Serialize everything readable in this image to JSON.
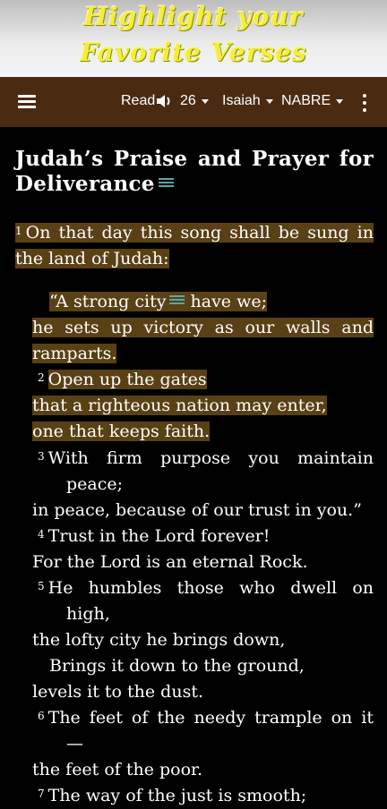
{
  "banner": {
    "line1": "Highlight your",
    "line2": "Favorite Verses"
  },
  "toolbar": {
    "read_label": "Read",
    "chapter": "26",
    "book": "Isaiah",
    "version": "NABRE"
  },
  "heading": "Judah’s Praise and Prayer for Deliverance",
  "lines": {
    "l1a": "On that day this song shall be sung in",
    "l1b": "the land of Judah:",
    "l1c": "“A strong city",
    "l1c2": " have we;",
    "l1d": "he sets up victory as our walls and",
    "l1e": "ramparts.",
    "l2a": "Open up the gates",
    "l2b": "that a righteous nation may enter,",
    "l2c": "one that keeps faith.",
    "l3a": "With firm purpose you maintain",
    "l3b": "peace;",
    "l3c": "in peace, because of our trust in you.”",
    "l4a": "Trust in the Lord forever!",
    "l4b": "For the Lord is an eternal Rock.",
    "l5a": "He humbles those who dwell on",
    "l5b": "high,",
    "l5c": "the lofty city he brings down,",
    "l5d": "Brings it down to the ground,",
    "l5e": "levels it to the dust.",
    "l6a": "The feet of the needy trample on it",
    "l6b": "—",
    "l6c": "the feet of the poor.",
    "l7a": "The way of the just is smooth;"
  },
  "verse_numbers": {
    "v1": "1",
    "v2": "2",
    "v3": "3",
    "v4": "4",
    "v5": "5",
    "v6": "6",
    "v7": "7"
  },
  "colors": {
    "toolbar": "#4a2b12",
    "highlight": "#5a4015",
    "footnote": "#5aa7a0",
    "banner_text": "#f2ee3a"
  },
  "icons": {
    "menu": "hamburger-menu-icon",
    "speaker": "speaker-icon",
    "more": "more-vert-icon",
    "footnote": "footnote-icon"
  }
}
